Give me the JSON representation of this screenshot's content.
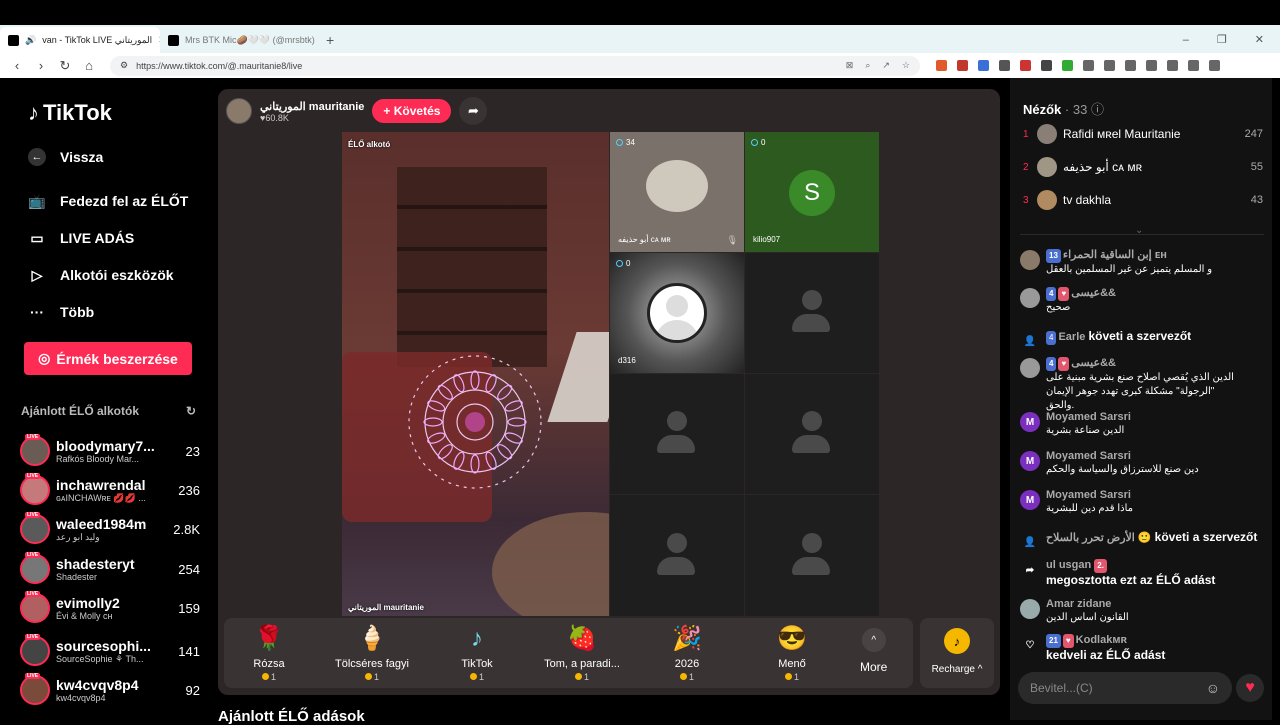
{
  "browser": {
    "tabs": [
      {
        "label": "van - TikTok LIVE الموريتاني",
        "active": true
      },
      {
        "label": "Mrs BTK Mic🥔🤍🤍 (@mrsbtk)",
        "active": false
      }
    ],
    "url": "https://www.tiktok.com/@.mauritanie8/live"
  },
  "sidebar": {
    "logo": "TikTok",
    "nav": [
      {
        "label": "Vissza",
        "icon": "back-arrow-icon"
      },
      {
        "label": "Fedezd fel az ÉLŐT",
        "icon": "tv-icon"
      },
      {
        "label": "LIVE ADÁS",
        "icon": "video-camera-icon"
      },
      {
        "label": "Alkotói eszközök",
        "icon": "creator-tools-icon"
      },
      {
        "label": "Több",
        "icon": "more-dots-icon"
      }
    ],
    "coin_button": "Érmék beszerzése",
    "recommended_title": "Ajánlott ÉLŐ alkotók",
    "live_tag": "LIVE",
    "creators": [
      {
        "name": "bloodymary7...",
        "sub": "Rafkós Bloody Mar...",
        "count": "23"
      },
      {
        "name": "inchawrendal",
        "sub": "ɢᴀINCHAWʀᴇ 💋💋 ...",
        "count": "236"
      },
      {
        "name": "waleed1984m",
        "sub": "وليد ابو رعد",
        "count": "2.8K"
      },
      {
        "name": "shadesteryt",
        "sub": "Shadester",
        "count": "254"
      },
      {
        "name": "evimolly2",
        "sub": "Évi & Molly ᴄʜ",
        "count": "159"
      },
      {
        "name": "sourcesophi...",
        "sub": "SourceSophie ⚘ Th...",
        "count": "141"
      },
      {
        "name": "kw4cvqv8p4",
        "sub": "kw4cvqv8p4",
        "count": "92"
      }
    ]
  },
  "stream": {
    "host_name": "الموريتاني mauritanie",
    "host_likes": "60.8K",
    "follow_label": "+ Követés",
    "main_label": "ÉLŐ alkotó",
    "main_bottom": "الموريتاني mauritanie",
    "guests": [
      {
        "count": "34",
        "name": "أبو حذيفه ᴄᴀ ᴍʀ"
      },
      {
        "count": "0",
        "name": "kilio907",
        "initial": "S"
      },
      {
        "count": "0",
        "name": "d316"
      }
    ],
    "gifts": [
      {
        "icon": "🌹",
        "name": "Rózsa",
        "price": "1"
      },
      {
        "icon": "🍦",
        "name": "Tölcséres fagyi",
        "price": "1"
      },
      {
        "icon": "♪",
        "name": "TikTok",
        "price": "1"
      },
      {
        "icon": "🍓",
        "name": "Tom, a paradi...",
        "price": "1"
      },
      {
        "icon": "🎉",
        "name": "2026",
        "price": "1"
      },
      {
        "icon": "😎",
        "name": "Menő",
        "price": "1"
      }
    ],
    "more_label": "More",
    "recharge_label": "Recharge ^"
  },
  "bottom_title": "Ajánlott ÉLŐ adások",
  "chatpanel": {
    "viewers_title": "Nézők",
    "viewers_count": "· 33",
    "viewers": [
      {
        "rank": "1",
        "name": "Rafidi ᴍʀel Mauritanie",
        "score": "247"
      },
      {
        "rank": "2",
        "name": "أبو حذيفه ᴄᴀ ᴍʀ",
        "score": "55"
      },
      {
        "rank": "3",
        "name": "tv dakhla",
        "score": "43"
      }
    ],
    "messages": [
      {
        "user": "إبن الساقية الحمراء ᴇʜ",
        "badge": "13",
        "text": "و المسلم يتميز عن غير المسلمين بالعقل"
      },
      {
        "user": "عيسى&&",
        "badge": "4",
        "text": "صحيح"
      },
      {
        "user": "Earle",
        "badge": "4",
        "text": "követi a szervezőt"
      },
      {
        "user": "عيسى&&",
        "badge": "4",
        "text": "الدين الذي يُقصي اصلاح صنع بشرية مبنية على \"الرجولة\" مشكلة كبرى تهدد جوهر الإيمان والحق."
      },
      {
        "user": "Moyamed Sarsri",
        "text": "الدين صناعة بشرية"
      },
      {
        "user": "Moyamed Sarsri",
        "text": "دين صنع للاسترزاق والسياسة والحكم"
      },
      {
        "user": "Moyamed Sarsri",
        "text": "ماذا قدم دين للبشرية"
      },
      {
        "user": "الأرض تحرر بالسلاح 🙂",
        "text": "követi a szervezőt"
      },
      {
        "user": "ul usgan",
        "badge": "2.",
        "text": "megosztotta ezt az ÉLŐ adást"
      },
      {
        "user": "Amar zidane",
        "text": "القانون اساس الدين"
      },
      {
        "user": "Kodlakᴍʀ",
        "badge": "21",
        "text": "kedveli az ÉLŐ adást"
      }
    ],
    "input_placeholder": "Bevitel...(C)"
  }
}
